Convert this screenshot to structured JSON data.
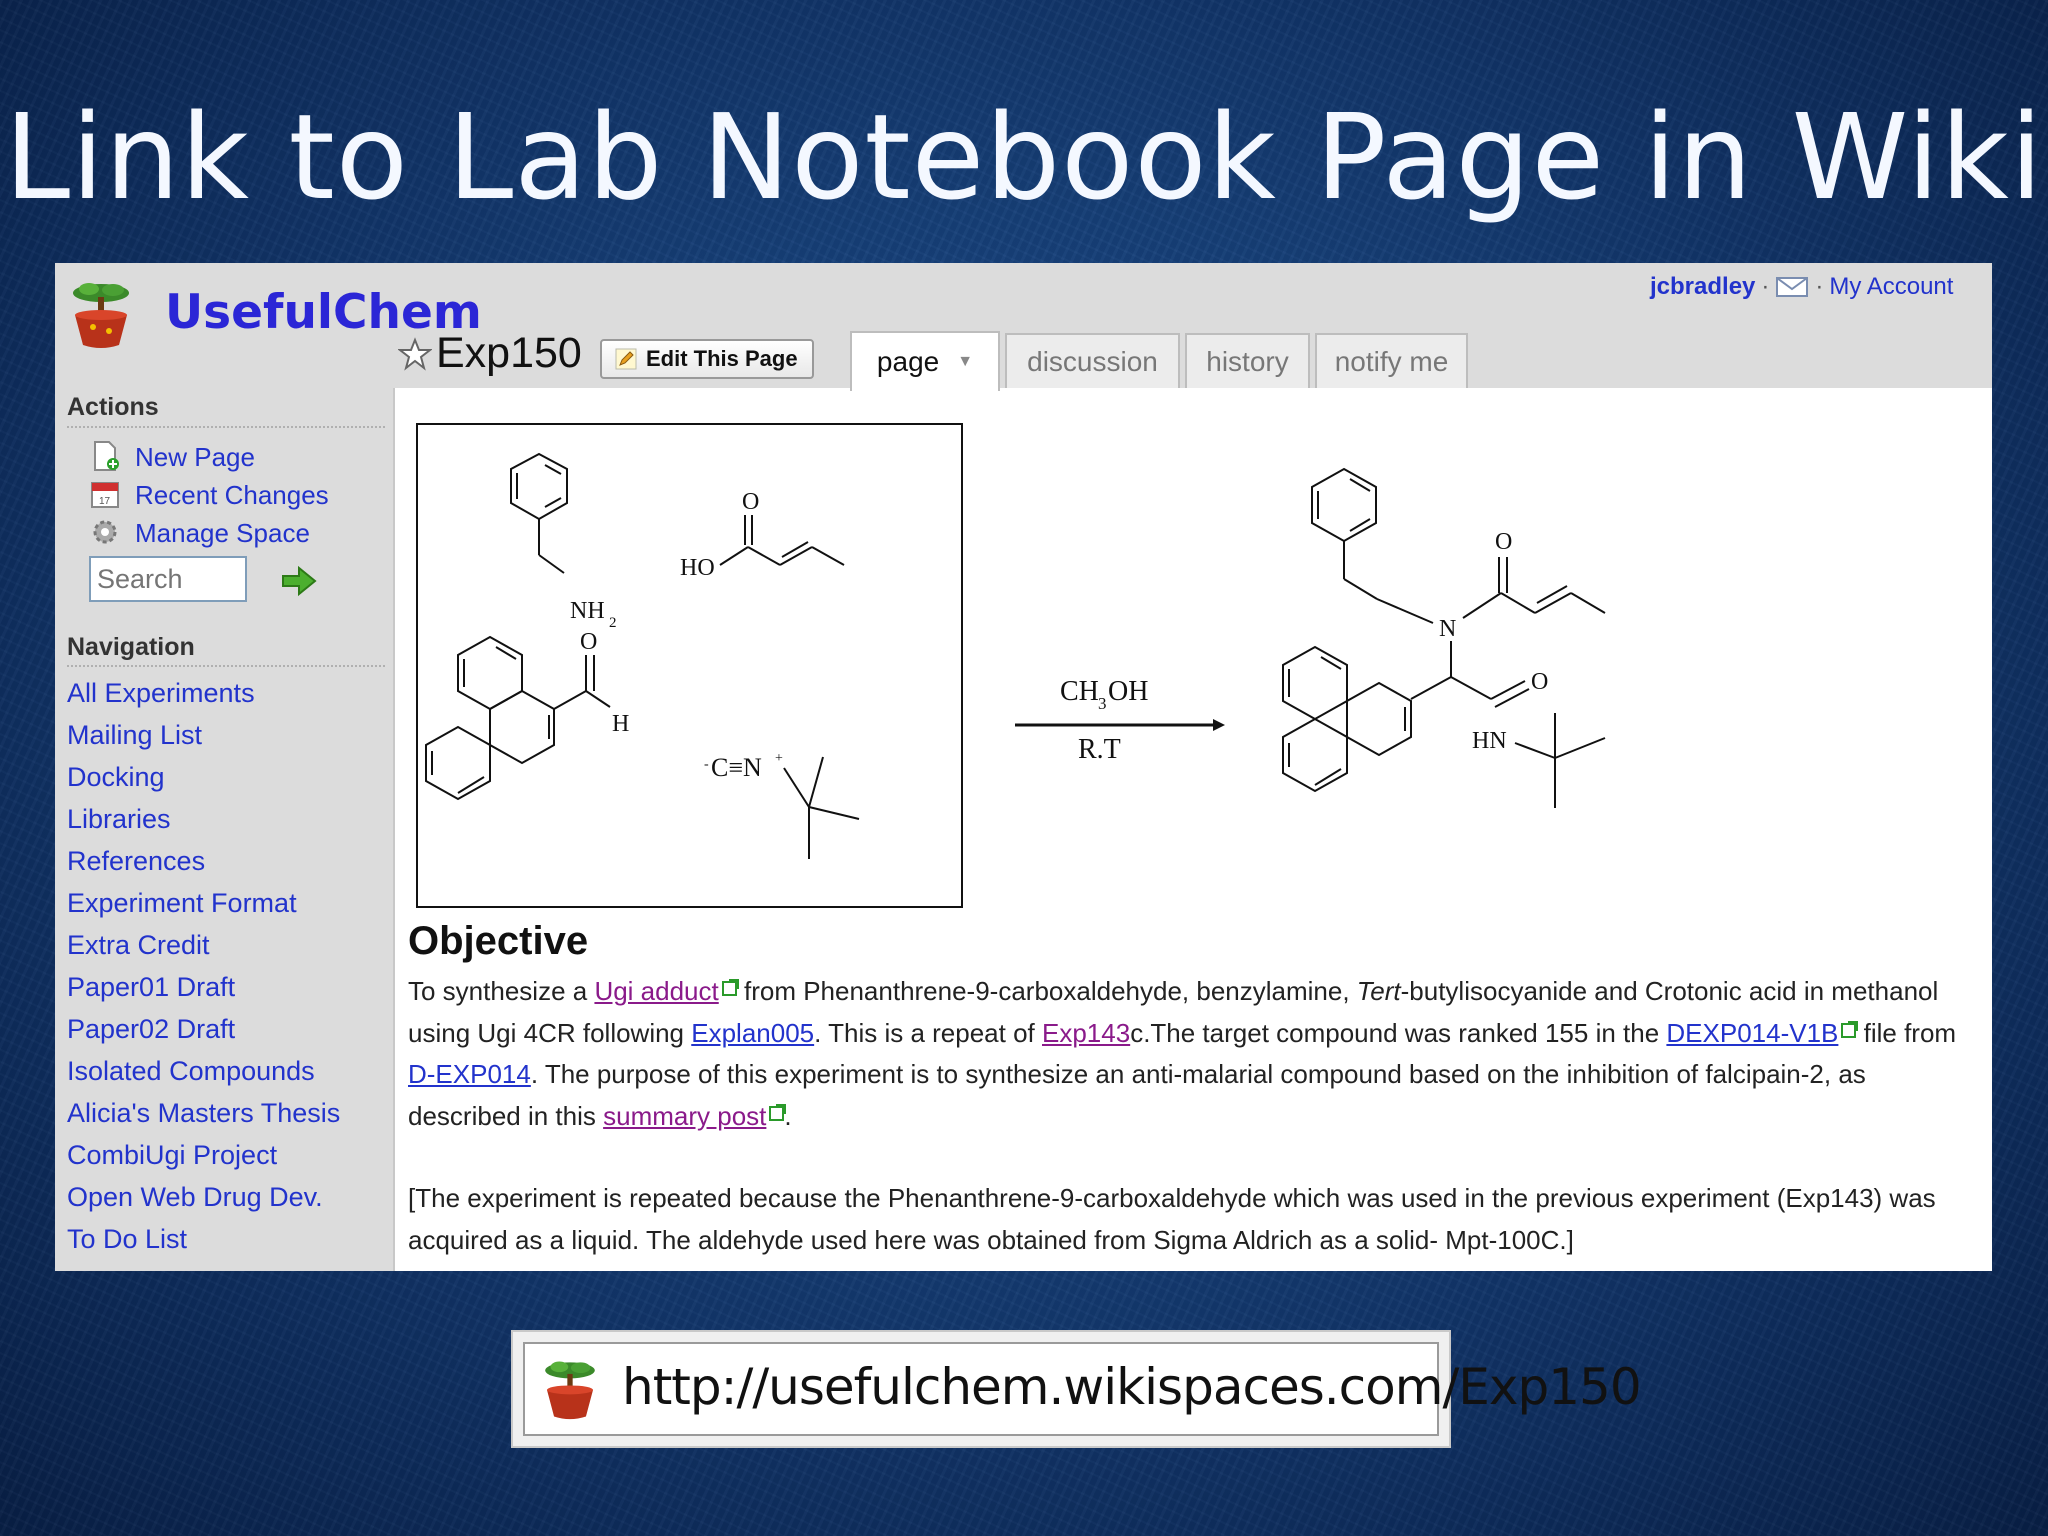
{
  "slide": {
    "title": "Link to Lab Notebook Page in Wiki"
  },
  "site": {
    "name": "UsefulChem"
  },
  "userbar": {
    "username": "jcbradley",
    "account": "My Account"
  },
  "page": {
    "name": "Exp150",
    "edit_label": "Edit This Page"
  },
  "tabs": [
    {
      "label": "page",
      "active": true
    },
    {
      "label": "discussion"
    },
    {
      "label": "history"
    },
    {
      "label": "notify me"
    }
  ],
  "sidebar": {
    "actions_heading": "Actions",
    "actions": [
      {
        "label": "New Page",
        "icon": "new-page-icon"
      },
      {
        "label": "Recent Changes",
        "icon": "calendar-icon"
      },
      {
        "label": "Manage Space",
        "icon": "gear-icon"
      }
    ],
    "search_placeholder": "Search",
    "navigation_heading": "Navigation",
    "navigation": [
      "All Experiments",
      "Mailing List",
      "Docking",
      "Libraries",
      "References",
      "Experiment Format",
      "Extra Credit",
      "Paper01 Draft",
      "Paper02 Draft",
      "Isolated Compounds",
      "Alicia's Masters Thesis",
      "CombiUgi Project",
      "Open Web Drug Dev.",
      "To Do List"
    ]
  },
  "scheme": {
    "reagent_labels": {
      "amine": "NH",
      "amine_sub": "2",
      "acid_ho": "HO",
      "acid_o": "O",
      "aldehyde_o": "O",
      "aldehyde_h": "H",
      "isocyanide": "C≡N",
      "isocyanide_minus": "-",
      "isocyanide_plus": "+"
    },
    "conditions": {
      "solvent": "CH",
      "solvent_sub": "3",
      "solvent_tail": "OH",
      "temp": "R.T"
    },
    "product_labels": {
      "n": "N",
      "o1": "O",
      "o2": "O",
      "hn": "HN"
    }
  },
  "objective": {
    "heading": "Objective",
    "p1": {
      "t1": "To synthesize a ",
      "link_ugi": "Ugi adduct",
      "t2": " from Phenanthrene-9-carboxaldehyde, benzylamine, ",
      "tert": "Tert",
      "t3": "-butylisocyanide and Crotonic acid in methanol using Ugi 4CR following ",
      "link_explan": "Explan005",
      "t4": ". This is a repeat of ",
      "link_exp143c": "Exp143",
      "t5": "c.The target compound was ranked 155 in the ",
      "link_dexp": "DEXP014-V1B",
      "t6": " file from ",
      "link_dexp2": "D-EXP014",
      "t7": ". The purpose of this experiment is to synthesize an anti-malarial compound based on the inhibition of falcipain-2, as described in this ",
      "link_summary": "summary post",
      "t8": "."
    },
    "p2": "[The experiment is repeated because the Phenanthrene-9-carboxaldehyde which was used in the previous experiment (Exp143) was acquired as a liquid. The aldehyde used here was obtained from Sigma Aldrich as a solid- Mpt-100C.]"
  },
  "url": {
    "text": "http://usefulchem.wikispaces.com/Exp150"
  },
  "colors": {
    "link": "#2233cc",
    "visited": "#8a1a8a",
    "brand": "#2b26d6"
  }
}
